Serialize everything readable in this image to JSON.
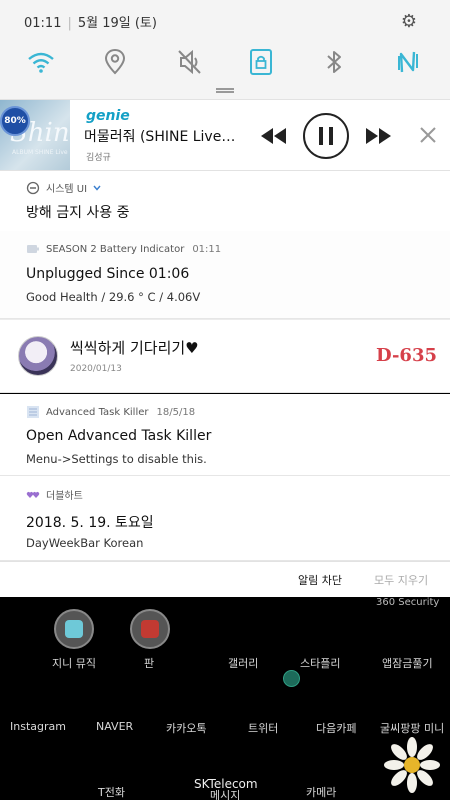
{
  "status": {
    "time": "01:11",
    "date": "5월 19일 (토)"
  },
  "quick_settings": {
    "icons": [
      "wifi-icon",
      "location-icon",
      "sound-mute-icon",
      "screen-lock-icon",
      "bluetooth-icon",
      "nfc-icon"
    ],
    "accent_color": "#3ab6d4"
  },
  "media": {
    "app": "genie",
    "song": "머물러줘 (SHINE Live…",
    "artist": "김성규",
    "album_script": "Shine",
    "album_sub": "ALBUM SHINE Live",
    "badge": "80%"
  },
  "notifications": {
    "system_ui": {
      "app": "시스템 UI",
      "title": "방해 금지 사용 중"
    },
    "battery": {
      "app": "SEASON 2 Battery Indicator",
      "time": "01:11",
      "title": "Unplugged Since 01:06",
      "text": "Good Health / 29.6 ° C / 4.06V"
    },
    "dday": {
      "title": "씩씩하게 기다리기♥",
      "date": "2020/01/13",
      "count": "D-635",
      "count_color": "#d6404a"
    },
    "task_killer": {
      "app": "Advanced Task Killer",
      "time": "18/5/18",
      "title": "Open Advanced Task Killer",
      "text": "Menu->Settings to disable this."
    },
    "doublehart": {
      "app": "더블하트",
      "title": "2018. 5. 19. 토요일",
      "text": "DayWeekBar Korean"
    }
  },
  "actions": {
    "block": "알림 차단",
    "clear_all": "모두 지우기"
  },
  "home": {
    "row1": [
      "지니 뮤직",
      "판",
      "갤러리",
      "스타플리",
      "앱잠금풀기"
    ],
    "top_right": "360 Security",
    "row2": [
      "Instagram",
      "NAVER",
      "카카오톡",
      "트위터",
      "다음카페",
      "굴씨팡팡 미니"
    ],
    "carrier": "SKTelecom",
    "row3": [
      "T전화",
      "메시지",
      "카메라"
    ]
  }
}
